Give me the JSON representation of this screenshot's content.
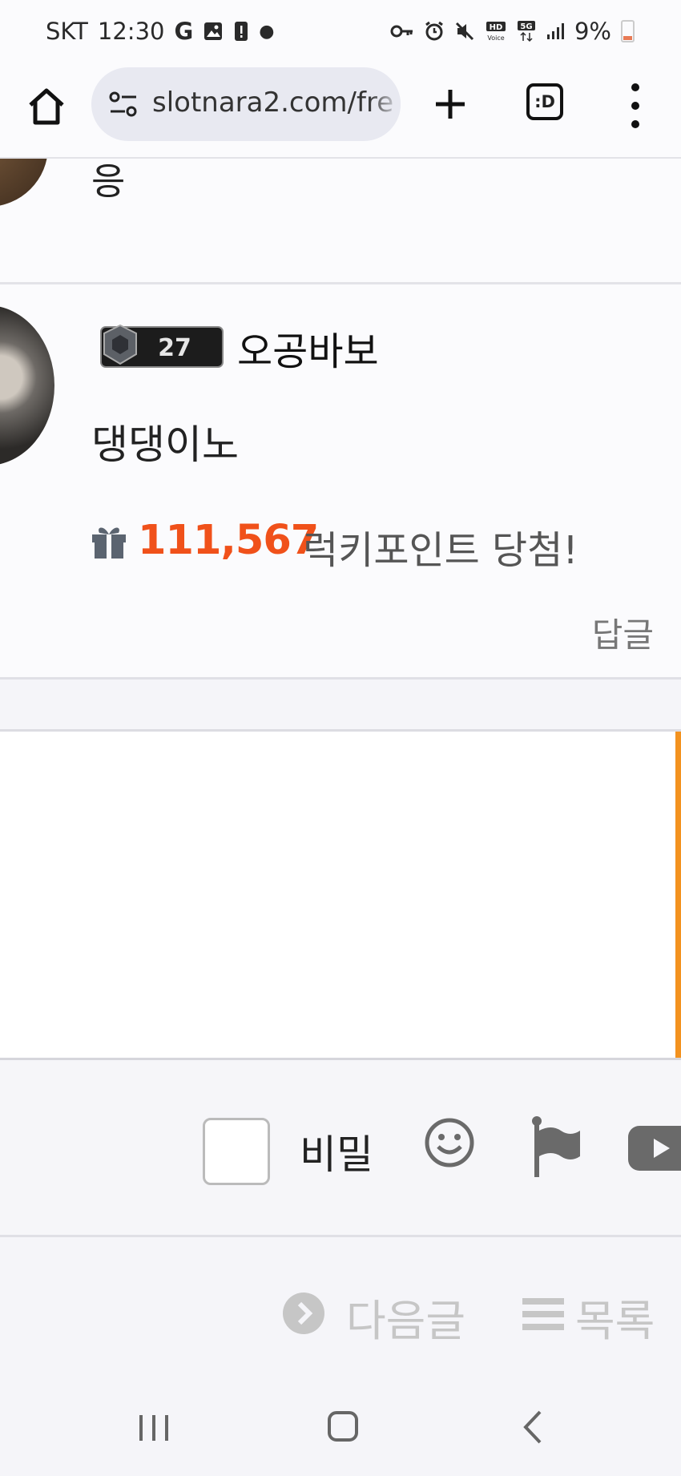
{
  "status_bar": {
    "carrier": "SKT",
    "time": "12:30",
    "battery": "9%"
  },
  "browser": {
    "url": "slotnara2.com/fre",
    "tab_count": ":D"
  },
  "comments": [
    {
      "text": "응"
    },
    {
      "level": "27",
      "nickname": "오공바보",
      "text": "댕댕이노",
      "lucky_points": "111,567",
      "lucky_text": "럭키포인트 당첨!",
      "reply_label": "답글"
    }
  ],
  "comment_form": {
    "secret_label": "비밀",
    "accent_color": "#f3921f"
  },
  "post_nav": {
    "next_label": "다음글",
    "list_label": "목록"
  },
  "colors": {
    "lucky_number": "#f0511a"
  }
}
